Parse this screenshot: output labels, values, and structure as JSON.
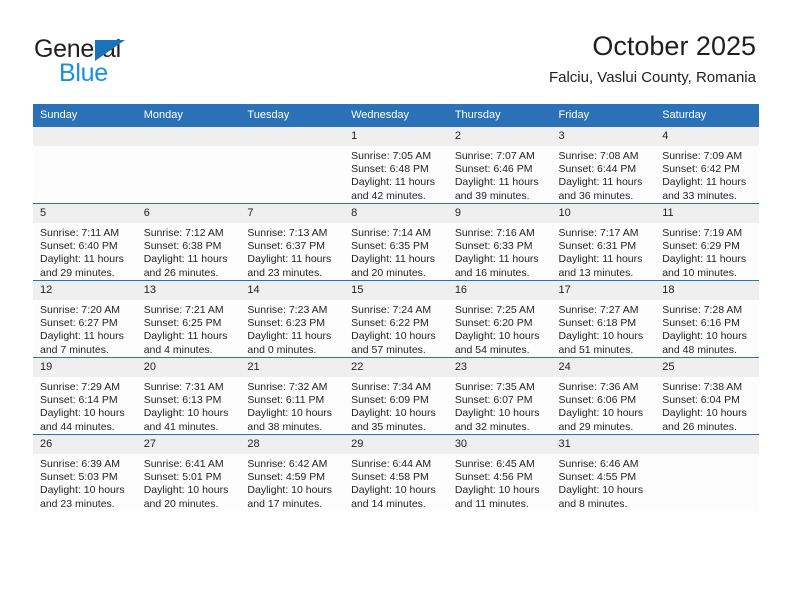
{
  "brand": {
    "name_part1": "General",
    "name_part2": "Blue"
  },
  "header": {
    "title": "October 2025",
    "subtitle": "Falciu, Vaslui County, Romania"
  },
  "colors": {
    "header_blue": "#2b71b8",
    "logo_blue": "#1a8fe0",
    "logo_triangle": "#1a72b8",
    "daynum_band": "#efefef",
    "text": "#231f20"
  },
  "weekdays": [
    "Sunday",
    "Monday",
    "Tuesday",
    "Wednesday",
    "Thursday",
    "Friday",
    "Saturday"
  ],
  "weeks": [
    [
      {
        "empty": true
      },
      {
        "empty": true
      },
      {
        "empty": true
      },
      {
        "day": "1",
        "sunrise": "Sunrise: 7:05 AM",
        "sunset": "Sunset: 6:48 PM",
        "daylight1": "Daylight: 11 hours",
        "daylight2": "and 42 minutes."
      },
      {
        "day": "2",
        "sunrise": "Sunrise: 7:07 AM",
        "sunset": "Sunset: 6:46 PM",
        "daylight1": "Daylight: 11 hours",
        "daylight2": "and 39 minutes."
      },
      {
        "day": "3",
        "sunrise": "Sunrise: 7:08 AM",
        "sunset": "Sunset: 6:44 PM",
        "daylight1": "Daylight: 11 hours",
        "daylight2": "and 36 minutes."
      },
      {
        "day": "4",
        "sunrise": "Sunrise: 7:09 AM",
        "sunset": "Sunset: 6:42 PM",
        "daylight1": "Daylight: 11 hours",
        "daylight2": "and 33 minutes."
      }
    ],
    [
      {
        "day": "5",
        "sunrise": "Sunrise: 7:11 AM",
        "sunset": "Sunset: 6:40 PM",
        "daylight1": "Daylight: 11 hours",
        "daylight2": "and 29 minutes."
      },
      {
        "day": "6",
        "sunrise": "Sunrise: 7:12 AM",
        "sunset": "Sunset: 6:38 PM",
        "daylight1": "Daylight: 11 hours",
        "daylight2": "and 26 minutes."
      },
      {
        "day": "7",
        "sunrise": "Sunrise: 7:13 AM",
        "sunset": "Sunset: 6:37 PM",
        "daylight1": "Daylight: 11 hours",
        "daylight2": "and 23 minutes."
      },
      {
        "day": "8",
        "sunrise": "Sunrise: 7:14 AM",
        "sunset": "Sunset: 6:35 PM",
        "daylight1": "Daylight: 11 hours",
        "daylight2": "and 20 minutes."
      },
      {
        "day": "9",
        "sunrise": "Sunrise: 7:16 AM",
        "sunset": "Sunset: 6:33 PM",
        "daylight1": "Daylight: 11 hours",
        "daylight2": "and 16 minutes."
      },
      {
        "day": "10",
        "sunrise": "Sunrise: 7:17 AM",
        "sunset": "Sunset: 6:31 PM",
        "daylight1": "Daylight: 11 hours",
        "daylight2": "and 13 minutes."
      },
      {
        "day": "11",
        "sunrise": "Sunrise: 7:19 AM",
        "sunset": "Sunset: 6:29 PM",
        "daylight1": "Daylight: 11 hours",
        "daylight2": "and 10 minutes."
      }
    ],
    [
      {
        "day": "12",
        "sunrise": "Sunrise: 7:20 AM",
        "sunset": "Sunset: 6:27 PM",
        "daylight1": "Daylight: 11 hours",
        "daylight2": "and 7 minutes."
      },
      {
        "day": "13",
        "sunrise": "Sunrise: 7:21 AM",
        "sunset": "Sunset: 6:25 PM",
        "daylight1": "Daylight: 11 hours",
        "daylight2": "and 4 minutes."
      },
      {
        "day": "14",
        "sunrise": "Sunrise: 7:23 AM",
        "sunset": "Sunset: 6:23 PM",
        "daylight1": "Daylight: 11 hours",
        "daylight2": "and 0 minutes."
      },
      {
        "day": "15",
        "sunrise": "Sunrise: 7:24 AM",
        "sunset": "Sunset: 6:22 PM",
        "daylight1": "Daylight: 10 hours",
        "daylight2": "and 57 minutes."
      },
      {
        "day": "16",
        "sunrise": "Sunrise: 7:25 AM",
        "sunset": "Sunset: 6:20 PM",
        "daylight1": "Daylight: 10 hours",
        "daylight2": "and 54 minutes."
      },
      {
        "day": "17",
        "sunrise": "Sunrise: 7:27 AM",
        "sunset": "Sunset: 6:18 PM",
        "daylight1": "Daylight: 10 hours",
        "daylight2": "and 51 minutes."
      },
      {
        "day": "18",
        "sunrise": "Sunrise: 7:28 AM",
        "sunset": "Sunset: 6:16 PM",
        "daylight1": "Daylight: 10 hours",
        "daylight2": "and 48 minutes."
      }
    ],
    [
      {
        "day": "19",
        "sunrise": "Sunrise: 7:29 AM",
        "sunset": "Sunset: 6:14 PM",
        "daylight1": "Daylight: 10 hours",
        "daylight2": "and 44 minutes."
      },
      {
        "day": "20",
        "sunrise": "Sunrise: 7:31 AM",
        "sunset": "Sunset: 6:13 PM",
        "daylight1": "Daylight: 10 hours",
        "daylight2": "and 41 minutes."
      },
      {
        "day": "21",
        "sunrise": "Sunrise: 7:32 AM",
        "sunset": "Sunset: 6:11 PM",
        "daylight1": "Daylight: 10 hours",
        "daylight2": "and 38 minutes."
      },
      {
        "day": "22",
        "sunrise": "Sunrise: 7:34 AM",
        "sunset": "Sunset: 6:09 PM",
        "daylight1": "Daylight: 10 hours",
        "daylight2": "and 35 minutes."
      },
      {
        "day": "23",
        "sunrise": "Sunrise: 7:35 AM",
        "sunset": "Sunset: 6:07 PM",
        "daylight1": "Daylight: 10 hours",
        "daylight2": "and 32 minutes."
      },
      {
        "day": "24",
        "sunrise": "Sunrise: 7:36 AM",
        "sunset": "Sunset: 6:06 PM",
        "daylight1": "Daylight: 10 hours",
        "daylight2": "and 29 minutes."
      },
      {
        "day": "25",
        "sunrise": "Sunrise: 7:38 AM",
        "sunset": "Sunset: 6:04 PM",
        "daylight1": "Daylight: 10 hours",
        "daylight2": "and 26 minutes."
      }
    ],
    [
      {
        "day": "26",
        "sunrise": "Sunrise: 6:39 AM",
        "sunset": "Sunset: 5:03 PM",
        "daylight1": "Daylight: 10 hours",
        "daylight2": "and 23 minutes."
      },
      {
        "day": "27",
        "sunrise": "Sunrise: 6:41 AM",
        "sunset": "Sunset: 5:01 PM",
        "daylight1": "Daylight: 10 hours",
        "daylight2": "and 20 minutes."
      },
      {
        "day": "28",
        "sunrise": "Sunrise: 6:42 AM",
        "sunset": "Sunset: 4:59 PM",
        "daylight1": "Daylight: 10 hours",
        "daylight2": "and 17 minutes."
      },
      {
        "day": "29",
        "sunrise": "Sunrise: 6:44 AM",
        "sunset": "Sunset: 4:58 PM",
        "daylight1": "Daylight: 10 hours",
        "daylight2": "and 14 minutes."
      },
      {
        "day": "30",
        "sunrise": "Sunrise: 6:45 AM",
        "sunset": "Sunset: 4:56 PM",
        "daylight1": "Daylight: 10 hours",
        "daylight2": "and 11 minutes."
      },
      {
        "day": "31",
        "sunrise": "Sunrise: 6:46 AM",
        "sunset": "Sunset: 4:55 PM",
        "daylight1": "Daylight: 10 hours",
        "daylight2": "and 8 minutes."
      },
      {
        "empty": true
      }
    ]
  ]
}
